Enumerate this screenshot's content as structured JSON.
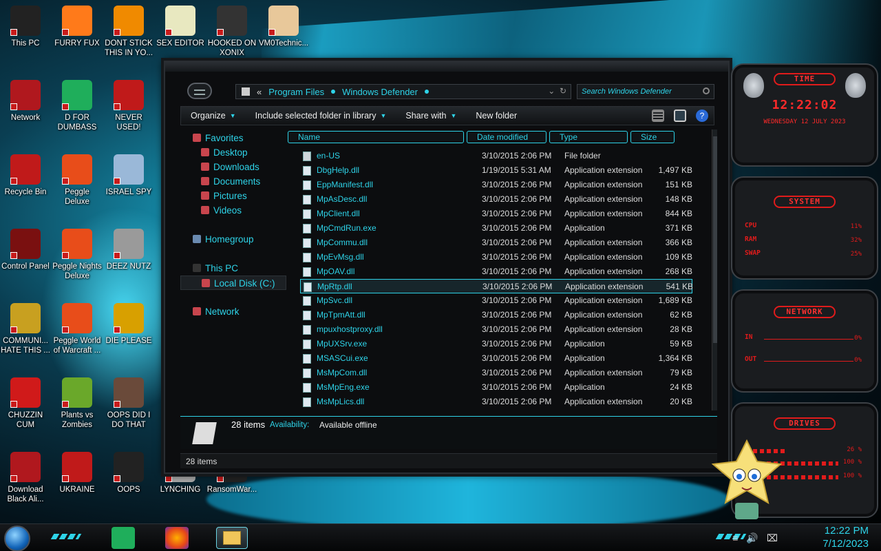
{
  "desktop": {
    "icons": [
      {
        "label": "This PC",
        "color": "#222"
      },
      {
        "label": "FURRY FUX",
        "color": "#ff7a1a"
      },
      {
        "label": "DONT STICK THIS IN YO...",
        "color": "#f08a00"
      },
      {
        "label": "SEX EDITOR",
        "color": "#e8e8c0"
      },
      {
        "label": "HOOKED ON XONIX",
        "color": "#333"
      },
      {
        "label": "VM0Technic...",
        "color": "#e8c89a"
      },
      {
        "label": "Network",
        "color": "#b0181e"
      },
      {
        "label": "D FOR DUMBASS",
        "color": "#1fae5b"
      },
      {
        "label": "NEVER USED!",
        "color": "#c01a1a"
      },
      {
        "label": "Recycle Bin",
        "color": "#c01a1a"
      },
      {
        "label": "Peggle Deluxe",
        "color": "#e84d1a"
      },
      {
        "label": "ISRAEL SPY",
        "color": "#9ab8d8"
      },
      {
        "label": "Control Panel",
        "color": "#7a1010"
      },
      {
        "label": "Peggle Nights Deluxe",
        "color": "#e84d1a"
      },
      {
        "label": "DEEZ NUTZ",
        "color": "#9a9a9a"
      },
      {
        "label": "COMMUNI... HATE THIS ...",
        "color": "#c8a020"
      },
      {
        "label": "Peggle World of Warcraft ...",
        "color": "#e84d1a"
      },
      {
        "label": "DIE PLEASE",
        "color": "#d8a000"
      },
      {
        "label": "CHUZZIN CUM",
        "color": "#d01a1a"
      },
      {
        "label": "Plants vs Zombies",
        "color": "#6aa82a"
      },
      {
        "label": "OOPS DID I DO THAT",
        "color": "#6a4a3a"
      },
      {
        "label": "Download Black Ali...",
        "color": "#b0181e"
      },
      {
        "label": "UKRAINE",
        "color": "#c01a1a"
      },
      {
        "label": "OOPS",
        "color": "#222"
      },
      {
        "label": "LYNCHING",
        "color": "#a8a8a8"
      },
      {
        "label": "RansomWar...",
        "color": "#222"
      }
    ]
  },
  "explorer": {
    "address": {
      "segments": [
        "Program Files",
        "Windows Defender"
      ],
      "back_glyph": "«",
      "search_placeholder": "Search Windows Defender"
    },
    "toolbar": {
      "organize": "Organize",
      "include": "Include selected folder in library",
      "share": "Share with",
      "new_folder": "New folder"
    },
    "nav": {
      "favorites": "Favorites",
      "desktop": "Desktop",
      "downloads": "Downloads",
      "documents": "Documents",
      "pictures": "Pictures",
      "videos": "Videos",
      "homegroup": "Homegroup",
      "this_pc": "This PC",
      "local_disk": "Local Disk (C:)",
      "network": "Network"
    },
    "columns": {
      "name": "Name",
      "date": "Date modified",
      "type": "Type",
      "size": "Size"
    },
    "files": [
      {
        "name": "en-US",
        "date": "3/10/2015 2:06 PM",
        "type": "File folder",
        "size": ""
      },
      {
        "name": "DbgHelp.dll",
        "date": "1/19/2015 5:31 AM",
        "type": "Application extension",
        "size": "1,497 KB"
      },
      {
        "name": "EppManifest.dll",
        "date": "3/10/2015 2:06 PM",
        "type": "Application extension",
        "size": "151 KB"
      },
      {
        "name": "MpAsDesc.dll",
        "date": "3/10/2015 2:06 PM",
        "type": "Application extension",
        "size": "148 KB"
      },
      {
        "name": "MpClient.dll",
        "date": "3/10/2015 2:06 PM",
        "type": "Application extension",
        "size": "844 KB"
      },
      {
        "name": "MpCmdRun.exe",
        "date": "3/10/2015 2:06 PM",
        "type": "Application",
        "size": "371 KB"
      },
      {
        "name": "MpCommu.dll",
        "date": "3/10/2015 2:06 PM",
        "type": "Application extension",
        "size": "366 KB"
      },
      {
        "name": "MpEvMsg.dll",
        "date": "3/10/2015 2:06 PM",
        "type": "Application extension",
        "size": "109 KB"
      },
      {
        "name": "MpOAV.dll",
        "date": "3/10/2015 2:06 PM",
        "type": "Application extension",
        "size": "268 KB"
      },
      {
        "name": "MpRtp.dll",
        "date": "3/10/2015 2:06 PM",
        "type": "Application extension",
        "size": "541 KB"
      },
      {
        "name": "MpSvc.dll",
        "date": "3/10/2015 2:06 PM",
        "type": "Application extension",
        "size": "1,689 KB"
      },
      {
        "name": "MpTpmAtt.dll",
        "date": "3/10/2015 2:06 PM",
        "type": "Application extension",
        "size": "62 KB"
      },
      {
        "name": "mpuxhostproxy.dll",
        "date": "3/10/2015 2:06 PM",
        "type": "Application extension",
        "size": "28 KB"
      },
      {
        "name": "MpUXSrv.exe",
        "date": "3/10/2015 2:06 PM",
        "type": "Application",
        "size": "59 KB"
      },
      {
        "name": "MSASCui.exe",
        "date": "3/10/2015 2:06 PM",
        "type": "Application",
        "size": "1,364 KB"
      },
      {
        "name": "MsMpCom.dll",
        "date": "3/10/2015 2:06 PM",
        "type": "Application extension",
        "size": "79 KB"
      },
      {
        "name": "MsMpEng.exe",
        "date": "3/10/2015 2:06 PM",
        "type": "Application",
        "size": "24 KB"
      },
      {
        "name": "MsMpLics.dll",
        "date": "3/10/2015 2:06 PM",
        "type": "Application extension",
        "size": "20 KB"
      }
    ],
    "selected_file": "MpRtp.dll",
    "details": {
      "count": "28 items",
      "availability_label": "Availability:",
      "availability_value": "Available offline"
    },
    "status": "28 items"
  },
  "gadgets": {
    "time": {
      "title": "TIME",
      "clock": "12:22:02",
      "date": "WEDNESDAY 12 JULY 2023"
    },
    "system": {
      "title": "SYSTEM",
      "cpu_label": "CPU",
      "cpu": "11%",
      "ram_label": "RAM",
      "ram": "32%",
      "swap_label": "SWAP",
      "swap": "25%"
    },
    "network": {
      "title": "NETWORK",
      "in_label": "IN",
      "in": "0%",
      "out_label": "OUT",
      "out": "0%"
    },
    "drives": {
      "title": "DRIVES",
      "d1": "26 %",
      "d2": "100 %",
      "d3": "100 %"
    }
  },
  "taskbar": {
    "time": "12:22 PM",
    "date": "7/12/2023"
  }
}
